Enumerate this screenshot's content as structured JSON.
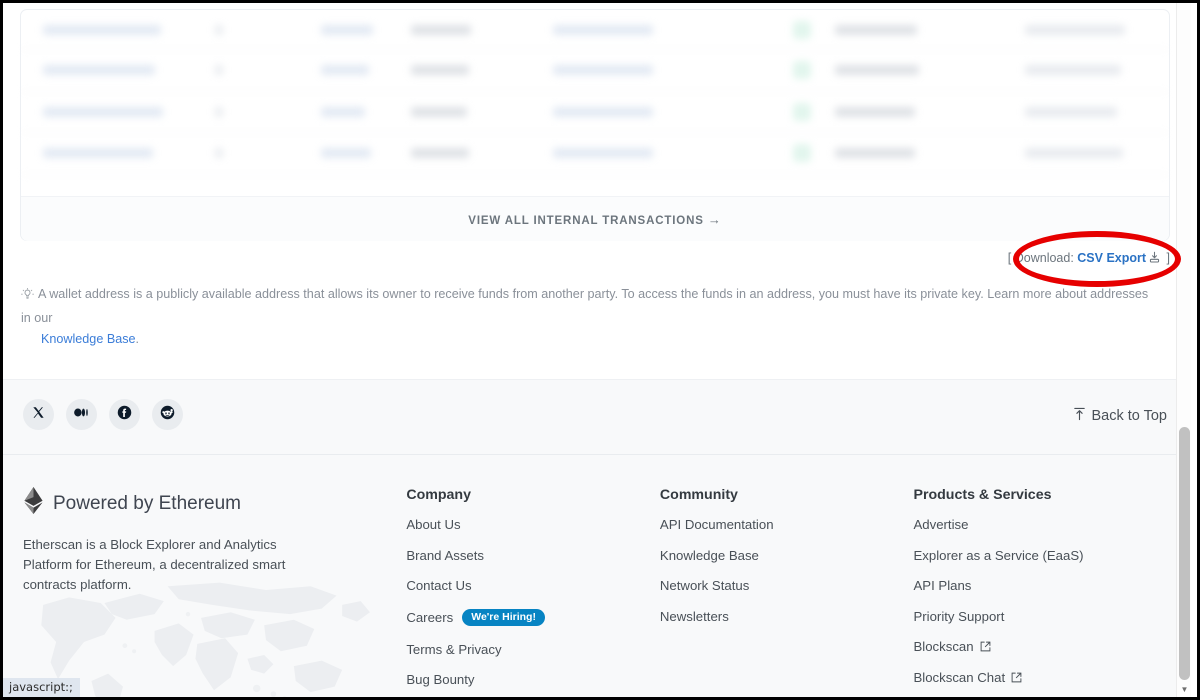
{
  "transactions_card": {
    "view_all_label": "VIEW ALL INTERNAL TRANSACTIONS",
    "view_all_arrow": "→",
    "rows": [
      {
        "hash": "",
        "method": "",
        "block": "",
        "age": "",
        "from": "",
        "to": "",
        "value": ""
      },
      {
        "hash": "",
        "method": "",
        "block": "",
        "age": "",
        "from": "",
        "to": "",
        "value": ""
      },
      {
        "hash": "",
        "method": "",
        "block": "",
        "age": "",
        "from": "",
        "to": "",
        "value": ""
      },
      {
        "hash": "",
        "method": "",
        "block": "",
        "age": "",
        "from": "",
        "to": "",
        "value": ""
      }
    ]
  },
  "download": {
    "prefix": "[ Download: ",
    "link_label": "CSV Export",
    "suffix": " ]",
    "icon": "download-icon"
  },
  "info_note": {
    "icon": "lightbulb-icon",
    "text": "A wallet address is a publicly available address that allows its owner to receive funds from another party. To access the funds in an address, you must have its private key. Learn more about addresses in our",
    "link_label": "Knowledge Base",
    "period": "."
  },
  "social": {
    "items": [
      {
        "name": "x-icon",
        "label": "X"
      },
      {
        "name": "medium-icon",
        "label": "Medium"
      },
      {
        "name": "facebook-icon",
        "label": "Facebook"
      },
      {
        "name": "reddit-icon",
        "label": "Reddit"
      }
    ],
    "back_to_top": "Back to Top",
    "back_to_top_icon": "arrow-up-icon"
  },
  "footer": {
    "brand": {
      "title": "Powered by Ethereum",
      "logo_icon": "ethereum-diamond-icon",
      "description": "Etherscan is a Block Explorer and Analytics Platform for Ethereum, a decentralized smart contracts platform."
    },
    "columns": [
      {
        "heading": "Company",
        "links": [
          {
            "label": "About Us"
          },
          {
            "label": "Brand Assets"
          },
          {
            "label": "Contact Us"
          },
          {
            "label": "Careers",
            "badge": "We're Hiring!"
          },
          {
            "label": "Terms & Privacy"
          },
          {
            "label": "Bug Bounty"
          }
        ]
      },
      {
        "heading": "Community",
        "links": [
          {
            "label": "API Documentation"
          },
          {
            "label": "Knowledge Base"
          },
          {
            "label": "Network Status"
          },
          {
            "label": "Newsletters"
          }
        ]
      },
      {
        "heading": "Products & Services",
        "links": [
          {
            "label": "Advertise"
          },
          {
            "label": "Explorer as a Service (EaaS)"
          },
          {
            "label": "API Plans"
          },
          {
            "label": "Priority Support"
          },
          {
            "label": "Blockscan",
            "external": true
          },
          {
            "label": "Blockscan Chat",
            "external": true
          }
        ]
      }
    ]
  },
  "statusbar": {
    "text": "javascript:;"
  },
  "annotation": {
    "shape": "red-ellipse",
    "color": "#e60000",
    "targets": "download-csv-export-link"
  },
  "colors": {
    "link_blue": "#2a72c4",
    "info_link_blue": "#3b7dd8",
    "hiring_badge": "#0784c3",
    "footer_bg": "#f8f9fa",
    "annotation_red": "#e60000",
    "muted_text": "#6c757d"
  }
}
